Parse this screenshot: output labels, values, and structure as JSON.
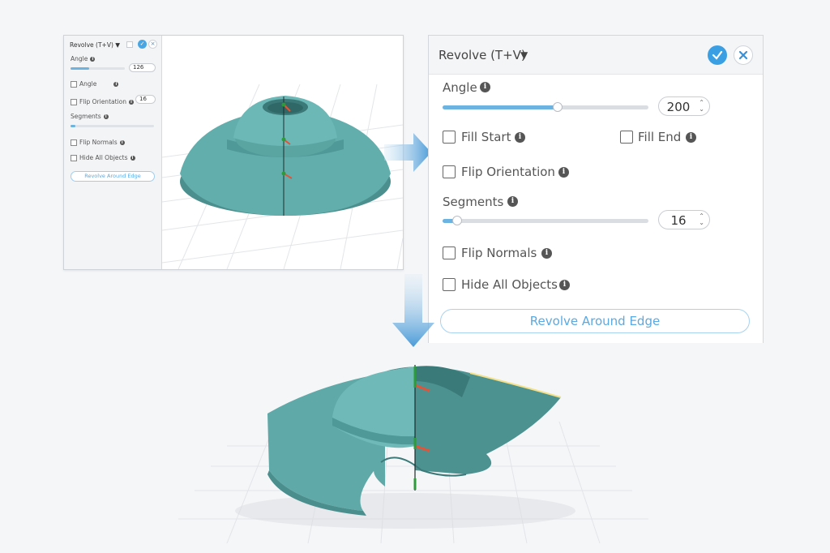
{
  "mini_panel": {
    "title": "Revolve (T+V) ▼",
    "angle_label": "Angle",
    "angle_value": "126",
    "angle_fraction": 0.35,
    "checkbox_angle": "Angle",
    "flip_orientation": "Flip Orientation",
    "segments_value": "16",
    "segments_label": "Segments",
    "segments_fraction": 0.06,
    "flip_normals": "Flip Normals",
    "hide_all_objects": "Hide All Objects",
    "revolve_edge_button": "Revolve Around Edge"
  },
  "dialog": {
    "title": "Revolve (T+V)",
    "caret": "▼",
    "angle_label": "Angle",
    "angle_value": "200",
    "angle_fraction": 0.56,
    "fill_start_label": "Fill Start",
    "fill_end_label": "Fill End",
    "flip_orientation_label": "Flip Orientation",
    "segments_label": "Segments",
    "segments_value": "16",
    "segments_fraction": 0.07,
    "flip_normals_label": "Flip Normals",
    "hide_all_objects_label": "Hide All Objects",
    "revolve_edge_button": "Revolve Around Edge"
  },
  "icons": {
    "info": "i",
    "stepper": "⌃⌄"
  },
  "colors": {
    "accent": "#3b9fe4",
    "model": "#5fa9a8",
    "model_dark": "#4a8f8e",
    "axis_green": "#2e9b3a",
    "axis_red": "#e0553a"
  }
}
